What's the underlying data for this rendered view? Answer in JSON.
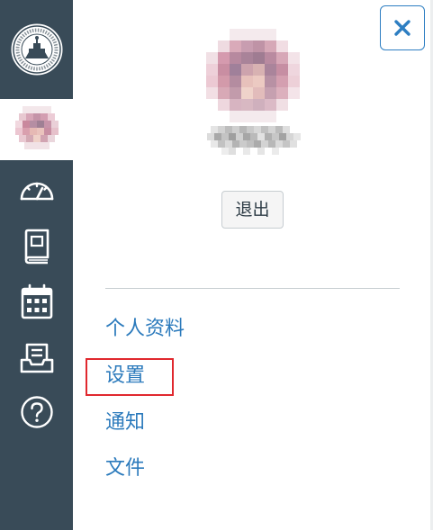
{
  "window": {
    "title": "个人资料"
  },
  "nav": {
    "logo": "university-seal-logo",
    "items": [
      {
        "name": "dashboard",
        "icon": "speedometer-icon"
      },
      {
        "name": "courses",
        "icon": "book-icon"
      },
      {
        "name": "calendar",
        "icon": "calendar-icon"
      },
      {
        "name": "inbox",
        "icon": "inbox-icon"
      },
      {
        "name": "help",
        "icon": "help-circle-icon"
      }
    ]
  },
  "tray": {
    "close_icon": "close-icon",
    "logout_label": "退出",
    "links": [
      {
        "label": "个人资料"
      },
      {
        "label": "设置"
      },
      {
        "label": "通知"
      },
      {
        "label": "文件"
      }
    ]
  },
  "colors": {
    "rail_bg": "#394b58",
    "link": "#2b7abc",
    "close_border": "#2d7ec2",
    "highlight": "#e0282e"
  }
}
